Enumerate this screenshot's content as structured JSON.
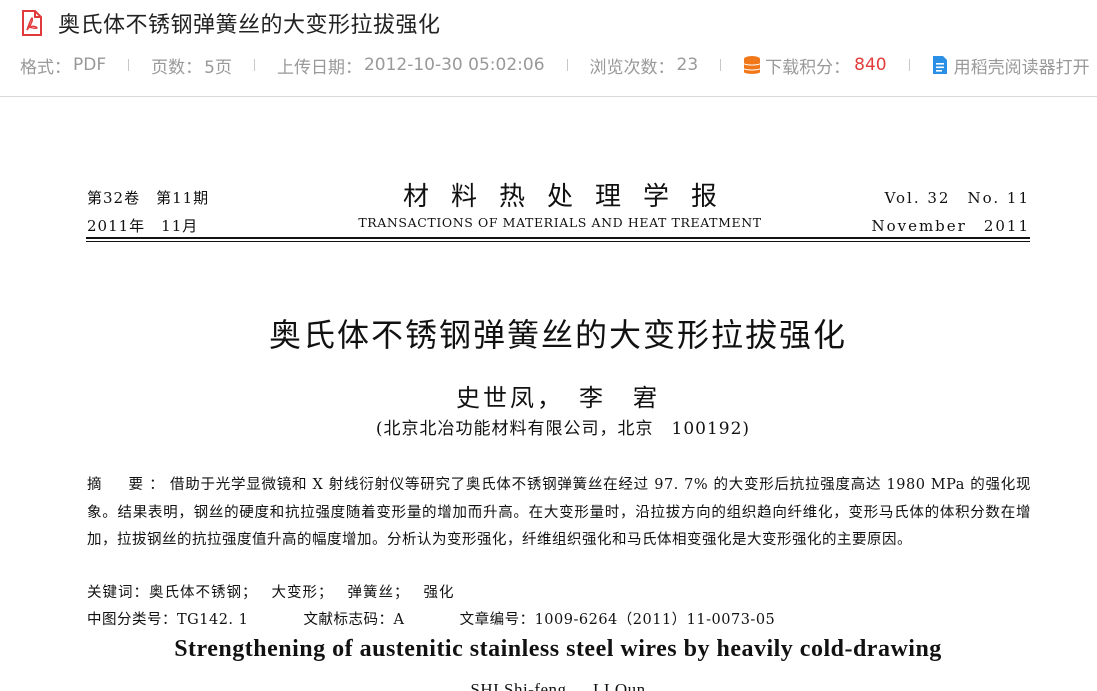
{
  "header": {
    "title": "奥氏体不锈钢弹簧丝的大变形拉拔强化",
    "pdf_icon": "pdf-file-icon",
    "meta": {
      "format_label": "格式：",
      "format_value": "PDF",
      "pages_label": "页数：",
      "pages_value": "5页",
      "upload_label": "上传日期：",
      "upload_value": "2012-10-30 05:02:06",
      "views_label": "浏览次数：",
      "views_value": "23",
      "points_label": "下载积分：",
      "points_value": "840",
      "open_reader_label": "用稻壳阅读器打开"
    },
    "colors": {
      "points": "#e23c3c",
      "accent_orange": "#f0771a",
      "accent_blue": "#2b8fe6",
      "pdf_red": "#e03a3a"
    }
  },
  "paper": {
    "volume_issue_cn": "第32卷　第11期",
    "date_cn": "2011年　11月",
    "journal_cn": "材料热处理学报",
    "journal_en": "TRANSACTIONS OF MATERIALS AND HEAT TREATMENT",
    "volume_issue_en": "Vol. 32　No. 11",
    "date_en": "November　2011",
    "title": "奥氏体不锈钢弹簧丝的大变形拉拔强化",
    "authors": "史世凤，　李　宭",
    "affiliation": "(北京北冶功能材料有限公司，北京　100192)",
    "abstract_label": "摘　要：",
    "abstract_text": "借助于光学显微镜和 X 射线衍射仪等研究了奥氏体不锈钢弹簧丝在经过 97. 7% 的大变形后抗拉强度高达 1980 MPa 的强化现象。结果表明，钢丝的硬度和抗拉强度随着变形量的增加而升高。在大变形量时，沿拉拔方向的组织趋向纤维化，变形马氏体的体积分数在增加，拉拔钢丝的抗拉强度值升高的幅度增加。分析认为变形强化，纤维组织强化和马氏体相变强化是大变形强化的主要原因。",
    "keywords_label": "关键词：",
    "keywords": [
      "奥氏体不锈钢；",
      "大变形；",
      "弹簧丝；",
      "强化"
    ],
    "clc": "中图分类号：TG142. 1",
    "doc_code": "文献标志码：A",
    "article_no": "文章编号：1009-6264（2011）11-0073-05",
    "title_en": "Strengthening of austenitic stainless steel wires by heavily cold-drawing",
    "authors_en": "SHI Shi-feng，　LI Qun"
  }
}
